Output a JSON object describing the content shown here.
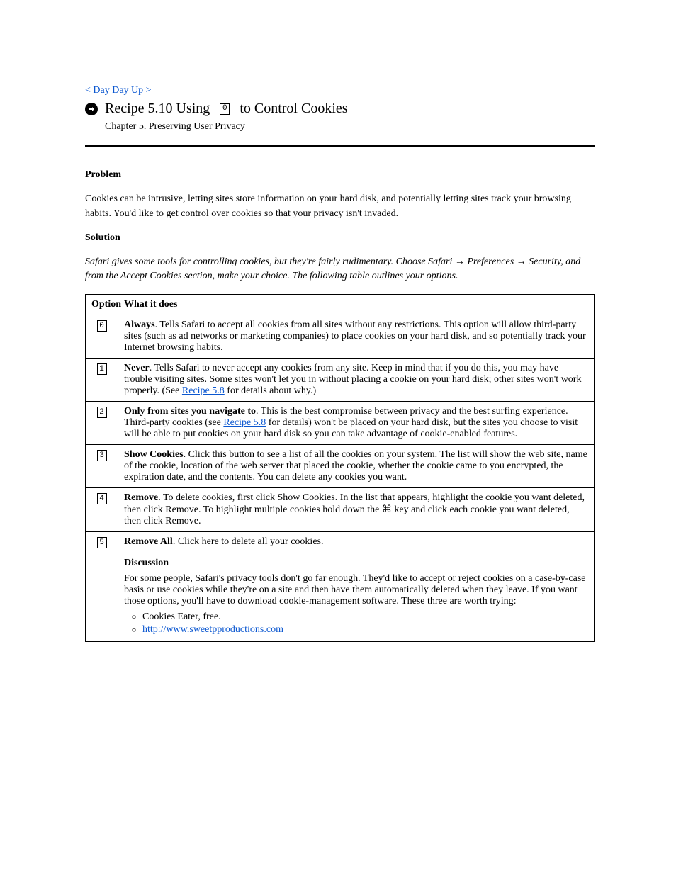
{
  "header": {
    "back_link": "< Day Day Up >",
    "title_pre": "Recipe 5.10 Using",
    "title_post": "to Control Cookies",
    "subtitle": "Chapter 5.  Preserving User Privacy"
  },
  "paragraphs": {
    "problem_h": "Problem",
    "problem_t": "Cookies can be intrusive, letting sites store information on your hard disk, and potentially letting sites track your browsing habits. You'd like to get control over cookies so that your privacy isn't invaded.",
    "solution_h": "Solution",
    "solution_t": "Safari gives some tools for controlling cookies, but they're fairly rudimentary. Choose Safari → Preferences → Security, and from the Accept Cookies section, make your choice. The following table outlines your options."
  },
  "table": {
    "head_opt": "Option",
    "head_desc": "What it does",
    "rows": [
      {
        "opt_glyph": "0",
        "b": "Always",
        "t": ". Tells Safari to accept all cookies from all sites without any restrictions. This option will allow third-party sites (such as ad networks or marketing companies) to place cookies on your hard disk, and so potentially track your Internet browsing habits."
      },
      {
        "opt_glyph": "1",
        "b": "Never",
        "t1": ". Tells Safari to never accept any cookies from any site. Keep in mind that if you do this, you may have trouble visiting sites. Some sites won't let you in without placing a cookie on your hard disk; other sites won't work properly. (See ",
        "link": "Recipe 5.8",
        "t2": " for details about why.)"
      },
      {
        "opt_glyph": "2",
        "b": "Only from sites you navigate to",
        "t1": ". This is the best compromise between privacy and the best surfing experience. Third-party cookies (see ",
        "link": "Recipe 5.8",
        "t2": " for details) won't be placed on your hard disk, but the sites you choose to visit will be able to put cookies on your hard disk so you can take advantage of cookie-enabled features."
      },
      {
        "opt_glyph": "3",
        "b": "Show Cookies",
        "t": ". Click this button to see a list of all the cookies on your system. The list will show the web site, name of the cookie, location of the web server that placed the cookie, whether the cookie came to you encrypted, the expiration date, and the contents. You can delete any cookies you want."
      },
      {
        "opt_glyph": "4",
        "b": "Remove",
        "t": ". To delete cookies, first click Show Cookies. In the list that appears, highlight the cookie you want deleted, then click Remove. To highlight multiple cookies hold down the ⌘ key and click each cookie you want deleted, then click Remove."
      },
      {
        "opt_glyph": "5",
        "b": "Remove All",
        "t": ". Click here to delete all your cookies."
      }
    ],
    "final": {
      "opt_glyph": "",
      "discussion_h": "Discussion",
      "discussion_t": "For some people, Safari's privacy tools don't go far enough. They'd like to accept or reject cookies on a case-by-case basis or use cookies while they're on a site and then have them automatically deleted when they leave. If you want those options, you'll have to download cookie-management software. These three are worth trying:",
      "items": [
        {
          "text": "Cookies Eater, free.",
          "is_link": false
        },
        {
          "text": "http://www.sweetpproductions.com",
          "is_link": true
        }
      ]
    }
  }
}
